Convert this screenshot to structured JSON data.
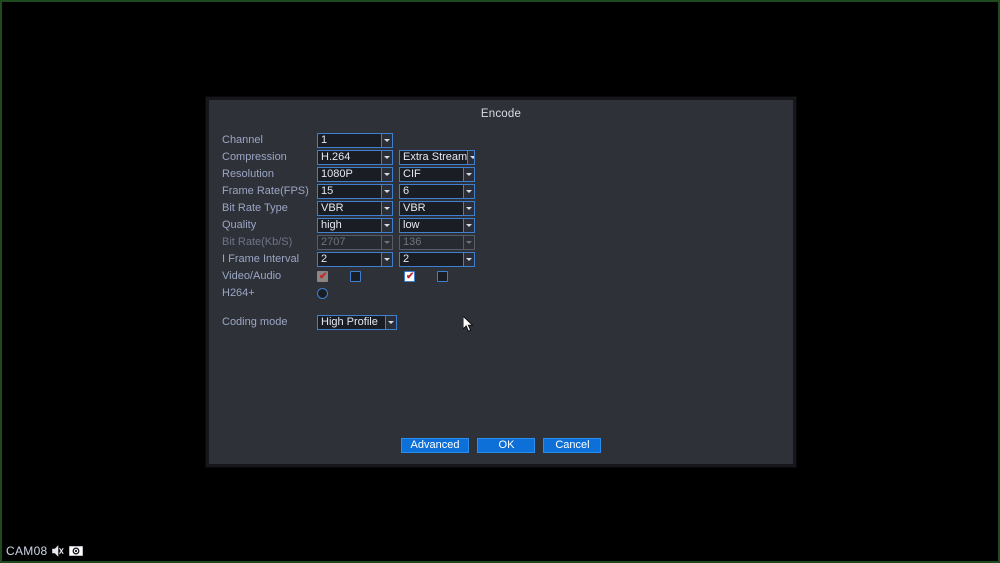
{
  "screen": {
    "background_color": "#000000",
    "border_color": "#1f4a1f"
  },
  "dialog": {
    "title": "Encode",
    "accent_color": "#3f7fd0",
    "background_color": "#2f3138",
    "button_color": "#0d6fd8"
  },
  "form": {
    "rows": [
      {
        "label": "Channel",
        "main": {
          "value": "1",
          "disabled": false
        },
        "sub": null
      },
      {
        "label": "Compression",
        "main": {
          "value": "H.264",
          "disabled": false
        },
        "sub": {
          "value": "Extra Stream",
          "disabled": false
        }
      },
      {
        "label": "Resolution",
        "main": {
          "value": "1080P",
          "disabled": false
        },
        "sub": {
          "value": "CIF",
          "disabled": false
        }
      },
      {
        "label": "Frame Rate(FPS)",
        "main": {
          "value": "15",
          "disabled": false
        },
        "sub": {
          "value": "6",
          "disabled": false
        }
      },
      {
        "label": "Bit Rate Type",
        "main": {
          "value": "VBR",
          "disabled": false
        },
        "sub": {
          "value": "VBR",
          "disabled": false
        }
      },
      {
        "label": "Quality",
        "main": {
          "value": "high",
          "disabled": false
        },
        "sub": {
          "value": "low",
          "disabled": false
        }
      },
      {
        "label": "Bit Rate(Kb/S)",
        "main": {
          "value": "2707",
          "disabled": true
        },
        "sub": {
          "value": "136",
          "disabled": true
        }
      },
      {
        "label": "I Frame Interval",
        "main": {
          "value": "2",
          "disabled": false
        },
        "sub": {
          "value": "2",
          "disabled": false
        }
      }
    ],
    "video_audio": {
      "label": "Video/Audio",
      "main_video": {
        "checked": true,
        "state": "disabled-checked"
      },
      "main_audio": {
        "checked": false,
        "state": "unchecked"
      },
      "sub_video": {
        "checked": true,
        "state": "checked"
      },
      "sub_audio": {
        "checked": false,
        "state": "unchecked"
      },
      "tick_glyph": "✔"
    },
    "h264plus": {
      "label": "H264+",
      "checked": false
    },
    "coding_mode": {
      "label": "Coding mode",
      "value": "High Profile"
    }
  },
  "buttons": {
    "advanced": "Advanced",
    "ok": "OK",
    "cancel": "Cancel"
  },
  "osd": {
    "camera_label": "CAM08",
    "icons": [
      "speaker-mute-icon",
      "record-camera-icon"
    ]
  }
}
